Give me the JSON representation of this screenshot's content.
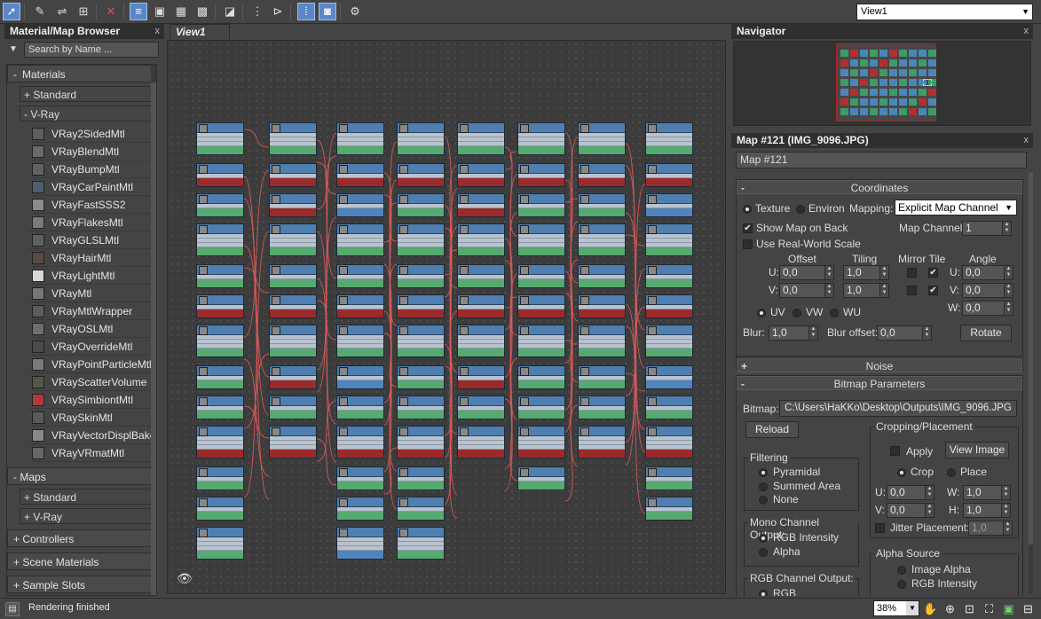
{
  "toolbar": {
    "view_select": "View1",
    "icons": [
      "select-icon",
      "eyedropper-icon",
      "assign-icon",
      "delete-icon",
      "layout-icon"
    ]
  },
  "browser": {
    "title": "Material/Map Browser",
    "close": "x",
    "search_placeholder": "Search by Name ...",
    "materials_label": "Materials",
    "materials_sign": "-",
    "standard_label": "Standard",
    "vray_label": "V-Ray",
    "vray_items": [
      {
        "label": "VRay2SidedMtl",
        "color": "#5e5e5e"
      },
      {
        "label": "VRayBlendMtl",
        "color": "#6a6a6a"
      },
      {
        "label": "VRayBumpMtl",
        "color": "#626262"
      },
      {
        "label": "VRayCarPaintMtl",
        "color": "#4e5d72"
      },
      {
        "label": "VRayFastSSS2",
        "color": "#8a8a8a"
      },
      {
        "label": "VRayFlakesMtl",
        "color": "#7a7a7a"
      },
      {
        "label": "VRayGLSLMtl",
        "color": "#606060"
      },
      {
        "label": "VRayHairMtl",
        "color": "#5a4a40"
      },
      {
        "label": "VRayLightMtl",
        "color": "#d8d8d8"
      },
      {
        "label": "VRayMtl",
        "color": "#777777"
      },
      {
        "label": "VRayMtlWrapper",
        "color": "#5c5c5c"
      },
      {
        "label": "VRayOSLMtl",
        "color": "#6e6e6e"
      },
      {
        "label": "VRayOverrideMtl",
        "color": "#4a4a4a"
      },
      {
        "label": "VRayPointParticleMtl",
        "color": "#7a7a7a"
      },
      {
        "label": "VRayScatterVolume",
        "color": "#4e5a44"
      },
      {
        "label": "VRaySimbiontMtl",
        "color": "#b03a3a"
      },
      {
        "label": "VRaySkinMtl",
        "color": "#5a5a5a"
      },
      {
        "label": "VRayVectorDisplBake",
        "color": "#888888"
      },
      {
        "label": "VRayVRmatMtl",
        "color": "#666666"
      }
    ],
    "maps_label": "Maps",
    "maps_standard": "Standard",
    "maps_vray": "V-Ray",
    "controllers": "Controllers",
    "scene_materials": "Scene Materials",
    "sample_slots": "Sample Slots"
  },
  "view": {
    "tab_label": "View1"
  },
  "navigator": {
    "title": "Navigator"
  },
  "map_panel": {
    "title": "Map #121 (IMG_9096.JPG)",
    "name_value": "Map #121",
    "coordinates": {
      "header": "Coordinates",
      "texture": "Texture",
      "environ": "Environ",
      "mapping_label": "Mapping:",
      "mapping_value": "Explicit Map Channel",
      "show_map_on_back": "Show Map on Back",
      "map_channel_label": "Map Channel:",
      "map_channel_value": "1",
      "use_real_world": "Use Real-World Scale",
      "offset": "Offset",
      "tiling": "Tiling",
      "mirror_tile": "Mirror Tile",
      "angle": "Angle",
      "u_label": "U:",
      "v_label": "V:",
      "w_label": "W:",
      "u_offset": "0,0",
      "v_offset": "0,0",
      "u_tiling": "1,0",
      "v_tiling": "1,0",
      "u_angle": "0,0",
      "v_angle": "0,0",
      "w_angle": "0,0",
      "uv": "UV",
      "vw": "VW",
      "wu": "WU",
      "blur_label": "Blur:",
      "blur_value": "1,0",
      "blur_offset_label": "Blur offset:",
      "blur_offset_value": "0,0",
      "rotate": "Rotate"
    },
    "noise": {
      "header": "Noise"
    },
    "bitmap_params": {
      "header": "Bitmap Parameters",
      "bitmap_label": "Bitmap:",
      "bitmap_path": "C:\\Users\\HaKKo\\Desktop\\Outputs\\IMG_9096.JPG",
      "reload": "Reload",
      "cropping": "Cropping/Placement",
      "apply": "Apply",
      "view_image": "View Image",
      "crop": "Crop",
      "place": "Place",
      "u_label": "U:",
      "v_label": "V:",
      "w_label": "W:",
      "h_label": "H:",
      "u_value": "0,0",
      "v_value": "0,0",
      "w_value": "1,0",
      "h_value": "1,0",
      "jitter": "Jitter Placement:",
      "jitter_value": "1,0",
      "filtering": "Filtering",
      "pyramidal": "Pyramidal",
      "summed_area": "Summed Area",
      "none": "None",
      "mono_channel": "Mono Channel Output:",
      "rgb_intensity": "RGB Intensity",
      "alpha": "Alpha",
      "rgb_channel": "RGB Channel Output:",
      "rgb": "RGB",
      "alpha_source": "Alpha Source",
      "image_alpha": "Image Alpha",
      "rgb_intensity2": "RGB Intensity"
    }
  },
  "status": {
    "message": "Rendering finished",
    "zoom": "38%"
  }
}
